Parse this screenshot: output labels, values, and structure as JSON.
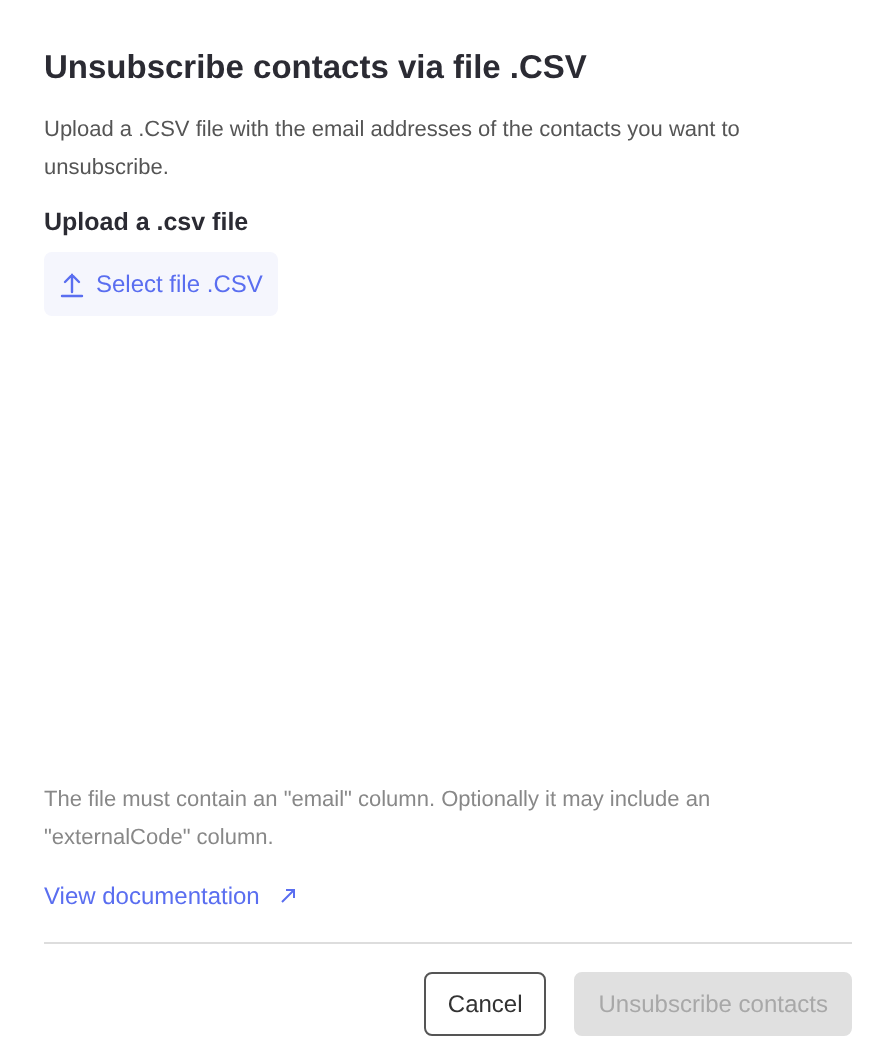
{
  "dialog": {
    "title": "Unsubscribe contacts via file .CSV",
    "description": "Upload a .CSV file with the email addresses of the contacts you want to unsubscribe.",
    "upload": {
      "label": "Upload a .csv file",
      "button": "Select file .CSV"
    },
    "note": "The file must contain an \"email\" column. Optionally it may include an \"externalCode\" column.",
    "link": "View documentation",
    "buttons": [
      {
        "label": "Cancel",
        "kind": "secondary",
        "disabled": false
      },
      {
        "label": "Unsubscribe contacts",
        "kind": "primary",
        "disabled": true
      }
    ]
  }
}
